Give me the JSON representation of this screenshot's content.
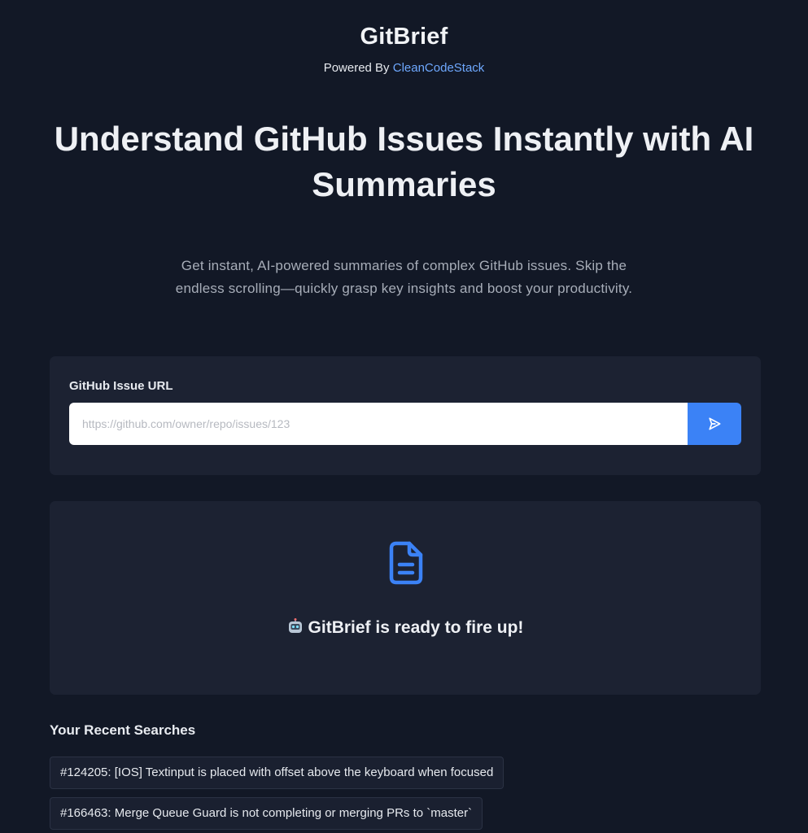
{
  "header": {
    "title": "GitBrief",
    "powered_prefix": "Powered By ",
    "powered_link": "CleanCodeStack"
  },
  "hero": {
    "title": "Understand GitHub Issues Instantly with AI Summaries",
    "subtitle": "Get instant, AI-powered summaries of complex GitHub issues. Skip the endless scrolling—quickly grasp key insights and boost your productivity."
  },
  "url_form": {
    "label": "GitHub Issue URL",
    "placeholder": "https://github.com/owner/repo/issues/123",
    "value": "",
    "submit_icon": "send-icon"
  },
  "ready": {
    "icon": "document-icon",
    "emoji_icon": "robot-icon",
    "message": "GitBrief is ready to fire up!"
  },
  "recent": {
    "title": "Your Recent Searches",
    "items": [
      "#124205: [IOS] Textinput is placed with offset above the keyboard when focused",
      "#166463: Merge Queue Guard is not completing or merging PRs to `master`"
    ]
  },
  "colors": {
    "background": "#121826",
    "card": "#1c2232",
    "accent": "#3b82f6",
    "link": "#6ea8fe"
  }
}
